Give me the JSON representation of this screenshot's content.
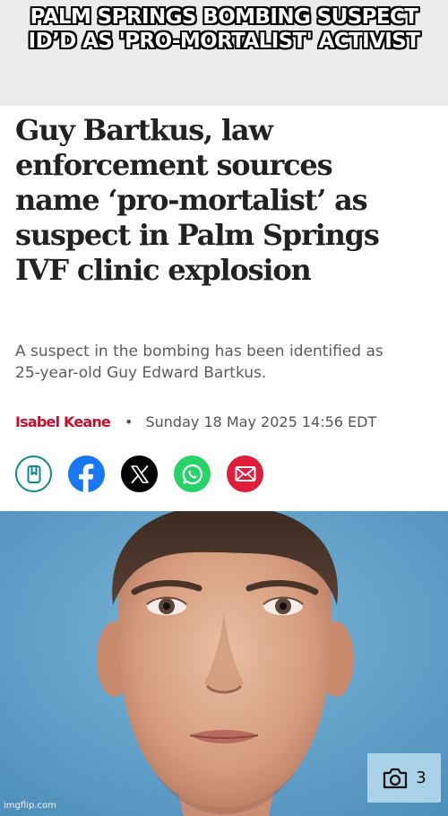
{
  "meme_caption": {
    "line1": "PALM SPRINGS BOMBING SUSPECT",
    "line2": "ID’D AS 'PRO-MORTALIST' ACTIVIST"
  },
  "article": {
    "headline_lines": [
      "Guy Bartkus, law",
      "enforcement sources",
      "name ‘pro-mortalist’ as",
      "suspect in Palm Springs",
      "IVF clinic explosion"
    ],
    "dek_lines": [
      "A suspect in the bombing has been identified as",
      "25-year-old Guy Edward Bartkus."
    ],
    "author": "Isabel Keane",
    "separator": "•",
    "dateline": "Sunday 18 May 2025 14:56 EDT",
    "author_color": "#c8102e"
  },
  "share_buttons": [
    {
      "icon": "bookmark-icon",
      "color": "#0f8a8a"
    },
    {
      "icon": "facebook-icon",
      "color": "#1877f2"
    },
    {
      "icon": "x-icon",
      "color": "#000000"
    },
    {
      "icon": "whatsapp-icon",
      "color": "#25d366"
    },
    {
      "icon": "email-icon",
      "color": "#e01e3c"
    }
  ],
  "photo": {
    "gallery_icon": "camera-icon",
    "gallery_count": "3"
  },
  "watermark": "imgflip.com"
}
